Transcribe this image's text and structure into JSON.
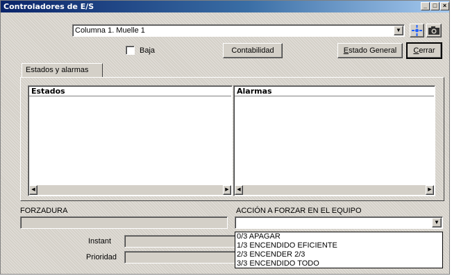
{
  "window": {
    "title": "Controladores de E/S"
  },
  "toolbar": {
    "location_value": "Columna 1. Muelle 1",
    "baja_label": "Baja",
    "baja_checked": false,
    "contabilidad_label": "Contabilidad",
    "estado_general_label": "Estado General",
    "cerrar_label": "Cerrar"
  },
  "tabs": [
    {
      "label": "Estados y alarmas",
      "active": true
    }
  ],
  "panels": {
    "estados": {
      "header": "Estados"
    },
    "alarmas": {
      "header": "Alarmas"
    }
  },
  "forzadura": {
    "label": "FORZADURA",
    "value": ""
  },
  "accion": {
    "label": "ACCIÓN A FORZAR EN EL EQUIPO",
    "selected": "",
    "options": [
      "0/3 APAGAR",
      "1/3 ENCENDIDO EFICIENTE",
      "2/3 ENCENDER 2/3",
      "3/3 ENCENDIDO TODO"
    ]
  },
  "fields": {
    "instant_label": "Instant",
    "prioridad_label": "Prioridad"
  },
  "icons": {
    "locate": "crosshair-icon",
    "camera": "camera-icon"
  },
  "colors": {
    "titlebar_start": "#0a246a",
    "titlebar_end": "#a6caf0",
    "face": "#d4d0c8"
  }
}
